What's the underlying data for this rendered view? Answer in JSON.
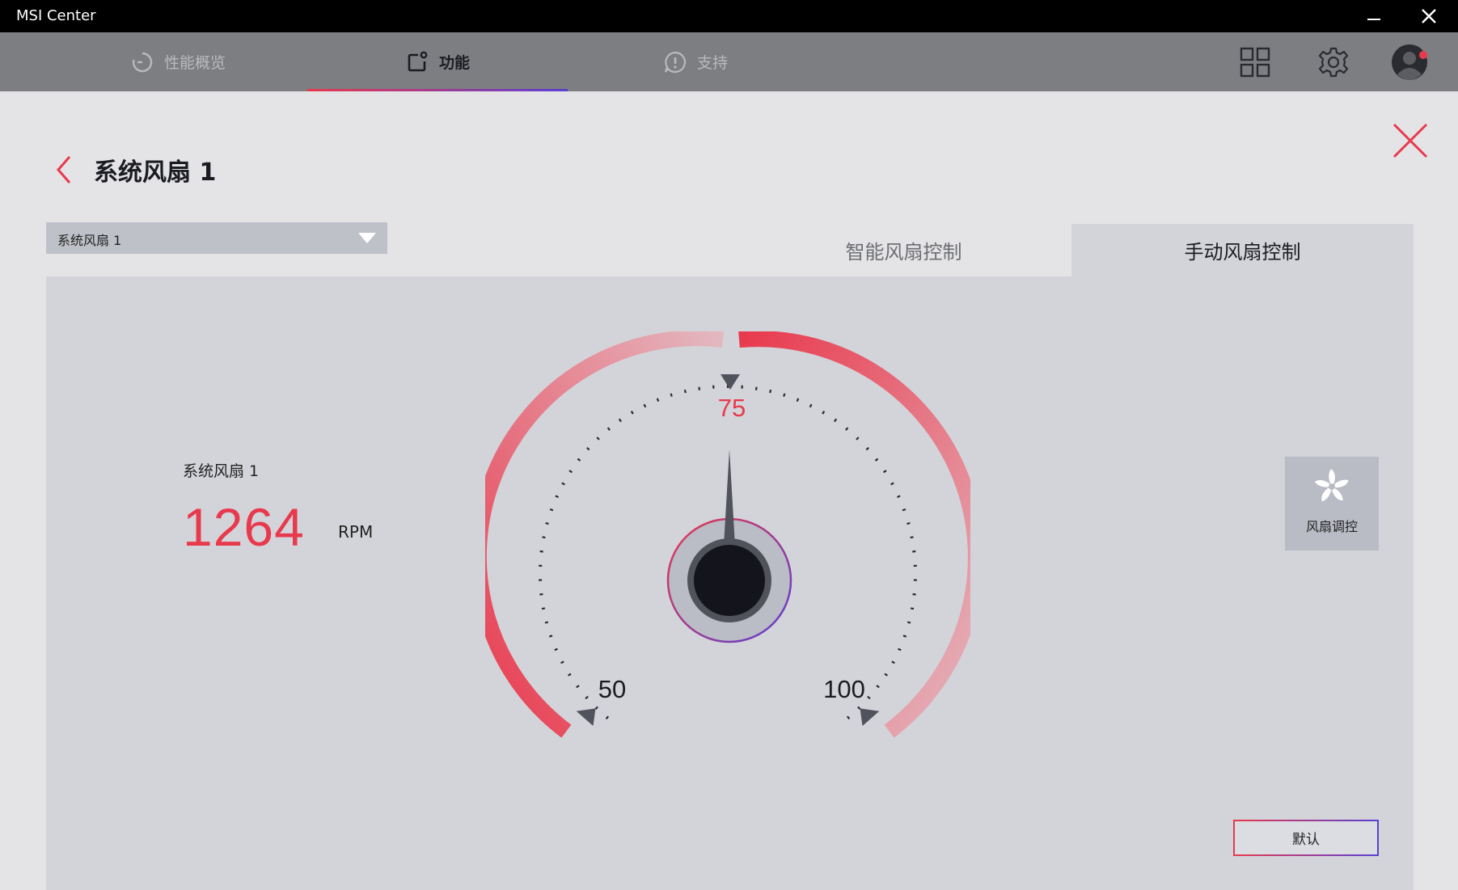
{
  "window": {
    "title": "MSI Center"
  },
  "nav": {
    "tabs": [
      {
        "label": "性能概览",
        "icon": "performance-icon"
      },
      {
        "label": "功能",
        "icon": "features-icon"
      },
      {
        "label": "支持",
        "icon": "support-icon"
      }
    ],
    "active_tab": "功能",
    "right_icons": [
      "grid-icon",
      "gear-icon",
      "avatar-icon"
    ]
  },
  "page": {
    "title": "系统风扇 1"
  },
  "fan_select": {
    "value": "系统风扇 1"
  },
  "mode_tabs": {
    "smart": "智能风扇控制",
    "manual": "手动风扇控制",
    "active": "手动风扇控制"
  },
  "readout": {
    "label": "系统风扇 1",
    "rpm": "1264",
    "unit": "RPM"
  },
  "gauge": {
    "min_label": "50",
    "mid_label": "75",
    "max_label": "100",
    "current_value": 75,
    "min": 50,
    "max": 100
  },
  "fan_control": {
    "label": "风扇调控"
  },
  "actions": {
    "default_label": "默认"
  },
  "colors": {
    "accent": "#e8394d",
    "accent_secondary": "#5a3fd4",
    "panel": "#d3d4d9",
    "nav": "#7d7e82"
  }
}
